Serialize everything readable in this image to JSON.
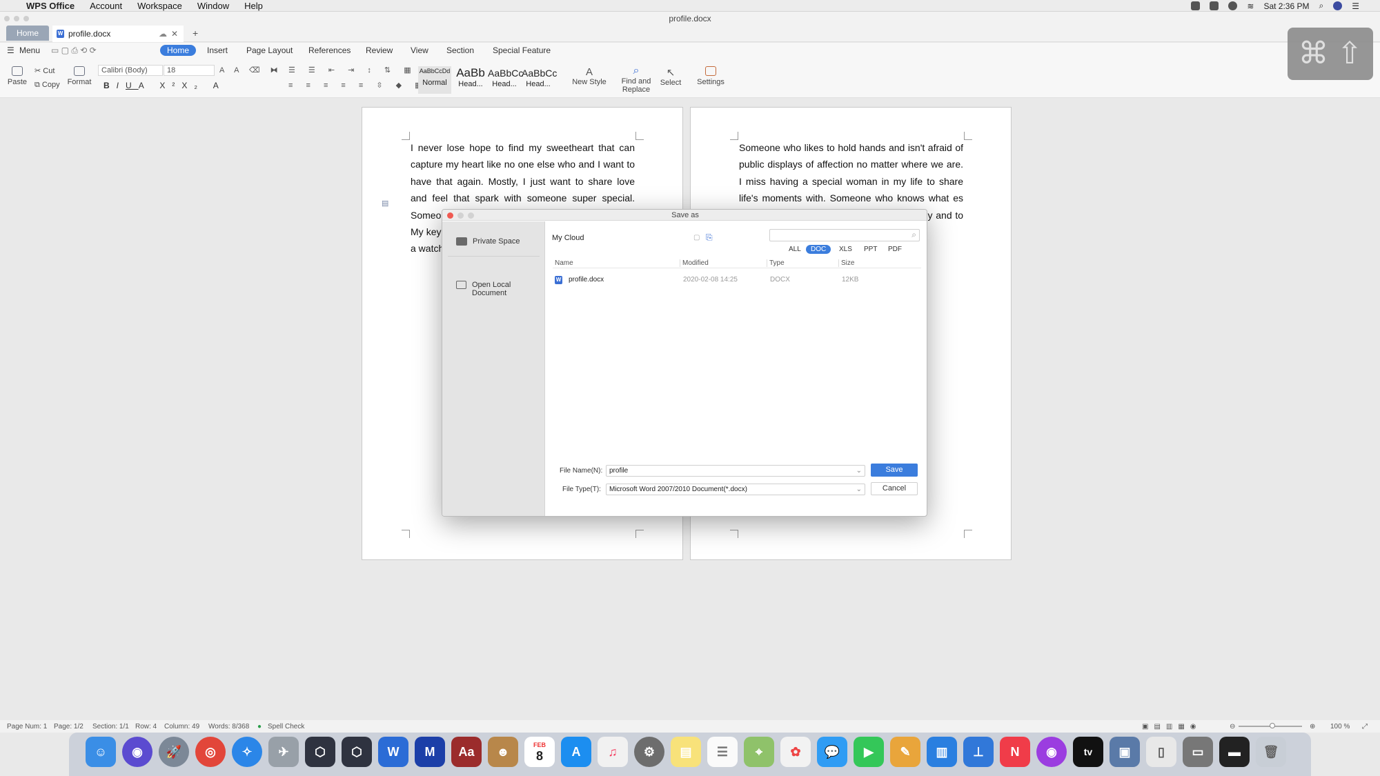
{
  "menubar": {
    "app": "WPS Office",
    "items": [
      "Account",
      "Workspace",
      "Window",
      "Help"
    ],
    "clock": "Sat 2:36 PM"
  },
  "window": {
    "title": "profile.docx"
  },
  "tabs": {
    "home": "Home",
    "doc": "profile.docx",
    "add": "+"
  },
  "ribbon": {
    "tabs": [
      "Home",
      "Insert",
      "Page Layout",
      "References",
      "Review",
      "View",
      "Section",
      "Special Feature"
    ],
    "menu": "Menu"
  },
  "toolbar": {
    "paste": "Paste",
    "cut": "Cut",
    "copy": "Copy",
    "format": "Format",
    "font_name": "Calibri (Body)",
    "font_size": "18",
    "styles": [
      {
        "preview": "AaBbCcDd",
        "name": "Normal"
      },
      {
        "preview": "AaBb",
        "name": "Head..."
      },
      {
        "preview": "AaBbCc",
        "name": "Head..."
      },
      {
        "preview": "AaBbCc",
        "name": "Head..."
      }
    ],
    "new_style": "New Style",
    "find": "Find and",
    "replace": "Replace",
    "select": "Select",
    "settings": "Settings"
  },
  "page1": {
    "text": "I never lose hope to find my sweetheart that can capture my heart like no one else who and I want to have that again. Mostly, I just want to share love and feel that spark with someone super special. Someo we mak but mo much t and en being showin My key respect and no faithful relation town, b home a watchin miss to her fac warm s"
  },
  "page2": {
    "text": "Someone who likes to hold hands and isn't afraid of public displays of affection no matter where we are. I miss having a special woman in my life to share life's moments with. Someone who knows what es along love to y special ated the have an silly and to be so uggle or nny and pose her don't be"
  },
  "dialog": {
    "title": "Save as",
    "sidebar": {
      "private_space": "Private Space",
      "open_local_1": "Open Local",
      "open_local_2": "Document"
    },
    "location": "My Cloud",
    "filters": [
      "ALL",
      "DOC",
      "XLS",
      "PPT",
      "PDF"
    ],
    "active_filter": "DOC",
    "columns": [
      "Name",
      "Modified",
      "Type",
      "Size"
    ],
    "files": [
      {
        "name": "profile.docx",
        "modified": "2020-02-08 14:25",
        "type": "DOCX",
        "size": "12KB"
      }
    ],
    "file_name_label": "File Name(N):",
    "file_name": "profile",
    "file_type_label": "File Type(T):",
    "file_type": "Microsoft Word 2007/2010 Document(*.docx)",
    "save": "Save",
    "cancel": "Cancel"
  },
  "status": {
    "page_num": "Page Num: 1",
    "page": "Page: 1/2",
    "section": "Section: 1/1",
    "row": "Row: 4",
    "column": "Column: 49",
    "words": "Words: 8/368",
    "spell": "Spell Check",
    "zoom": "100 %"
  },
  "dock": {
    "calendar_month": "FEB",
    "calendar_day": "8",
    "dict": "Aa",
    "tv": "tv"
  }
}
